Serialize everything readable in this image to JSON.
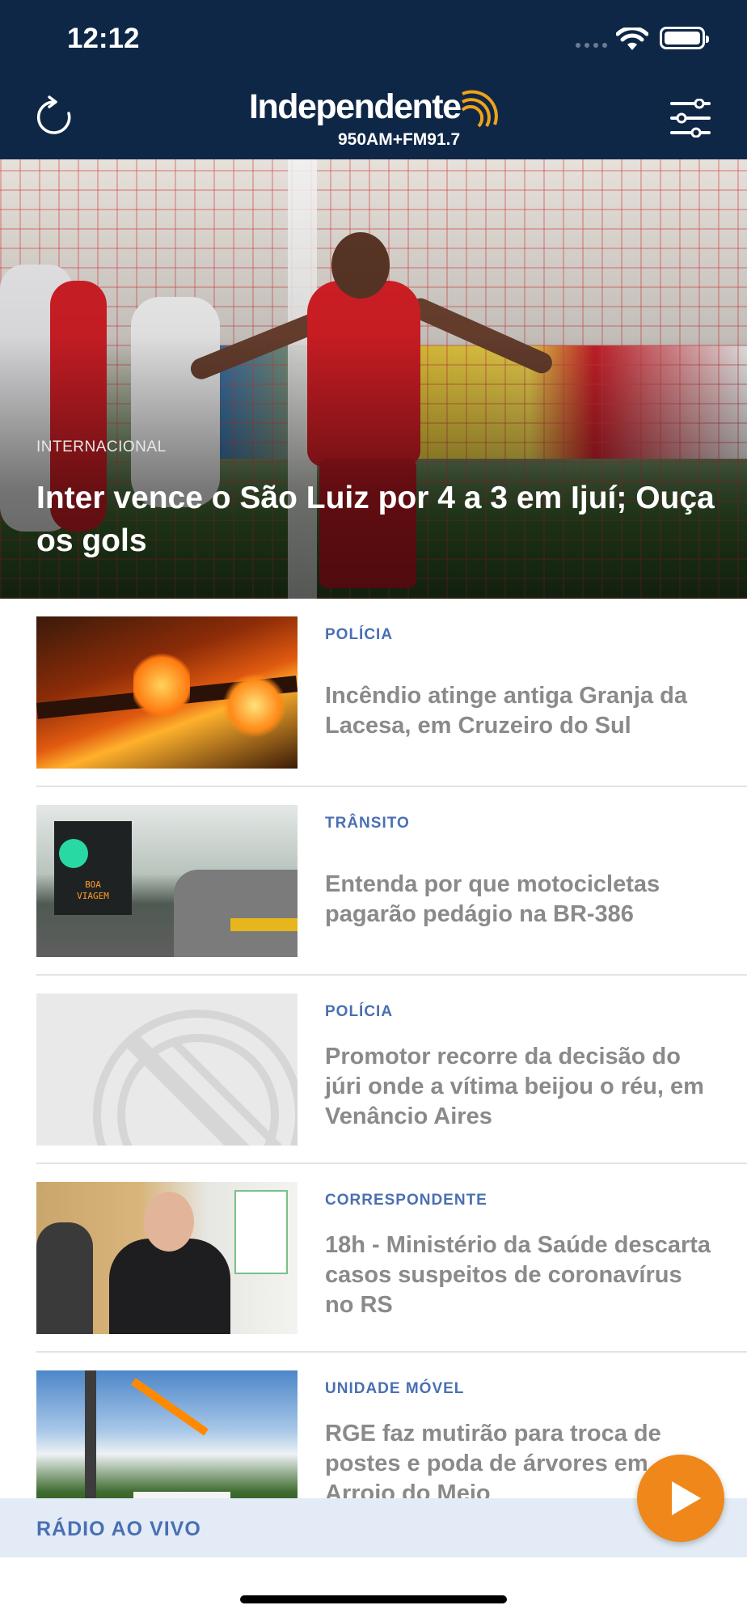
{
  "status_bar": {
    "time": "12:12"
  },
  "header": {
    "logo_name": "Independente",
    "logo_frequencies": "950AM+FM91.7",
    "refresh_icon": "refresh-icon",
    "menu_icon": "sliders-menu-icon",
    "background": "#0f2747"
  },
  "featured": {
    "category": "INTERNACIONAL",
    "title": "Inter vence o São Luiz por 4 a 3 em Ijuí; Ouça os gols"
  },
  "news": [
    {
      "category": "POLÍCIA",
      "title": "Incêndio atinge antiga Granja da Lacesa, em Cruzeiro do Sul"
    },
    {
      "category": "TRÂNSITO",
      "title": "Entenda por que motocicletas pagarão pedágio na BR-386",
      "sign_text": "BOA VIAGEM"
    },
    {
      "category": "POLÍCIA",
      "title": "Promotor recorre da decisão do júri onde a vítima beijou o réu, em Venâncio Aires"
    },
    {
      "category": "CORRESPONDENTE",
      "title": "18h - Ministério da Saúde descarta casos suspeitos de coronavírus no RS"
    },
    {
      "category": "UNIDADE MÓVEL",
      "title": "RGE faz mutirão para troca de postes e poda de árvores em Arroio do Meio"
    }
  ],
  "radio_bar": {
    "label": "RÁDIO AO VIVO",
    "play_icon": "play-icon"
  },
  "colors": {
    "accent": "#f0871a",
    "category_blue": "#4a6fb3",
    "title_gray": "#8a8a8a",
    "radio_bar_bg": "#e3ecf6"
  }
}
